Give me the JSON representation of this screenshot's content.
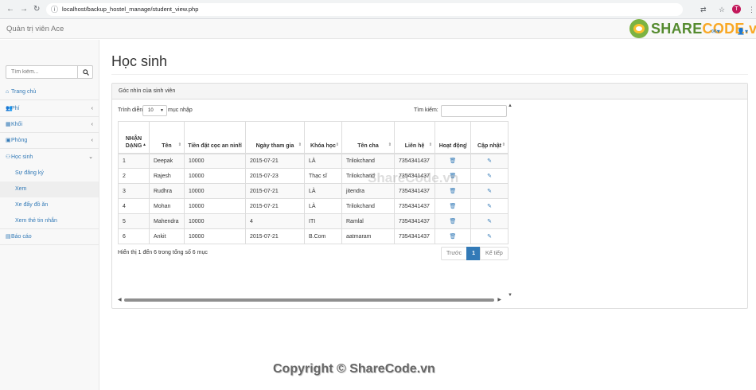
{
  "browser": {
    "url": "localhost/backup_hostel_manage/student_view.php",
    "profile_initial": "T"
  },
  "navbar": {
    "brand": "Quản trị viên Ace",
    "logo_text_a": "SHARE",
    "logo_text_b": "CODE.vn"
  },
  "sidebar": {
    "search_placeholder": "Tìm kiếm...",
    "items": [
      {
        "label": "Trang chủ"
      },
      {
        "label": "Phí"
      },
      {
        "label": "Khối"
      },
      {
        "label": "Phòng"
      },
      {
        "label": "Học sinh"
      },
      {
        "label": "Báo cáo"
      }
    ],
    "sub_items": [
      {
        "label": "Sự đăng ký"
      },
      {
        "label": "Xem"
      },
      {
        "label": "Xe đẩy đồ ăn"
      },
      {
        "label": "Xem thẻ tin nhắn"
      }
    ]
  },
  "main": {
    "title": "Học sinh",
    "panel_heading": "Góc nhìn của sinh viên",
    "length_label_before": "Trình diễn",
    "length_value": "10",
    "length_label_after": "mục nhập",
    "search_label": "Tìm kiếm:",
    "columns": [
      "NHẬN DẠNG",
      "Tên",
      "Tiền đặt cọc an ninh",
      "Ngày tham gia",
      "Khóa học",
      "Tên cha",
      "Liên hệ",
      "Hoạt động",
      "Cập nhật"
    ],
    "rows": [
      [
        "1",
        "Deepak",
        "10000",
        "2015-07-21",
        "LÀ",
        "Trilokchand",
        "7354341437"
      ],
      [
        "2",
        "Rajesh",
        "10000",
        "2015-07-23",
        "Thạc sĩ",
        "Trilokchand",
        "7354341437"
      ],
      [
        "3",
        "Rudhra",
        "10000",
        "2015-07-21",
        "LÀ",
        "jitendra",
        "7354341437"
      ],
      [
        "4",
        "Mohan",
        "10000",
        "2015-07-21",
        "LÀ",
        "Trilokchand",
        "7354341437"
      ],
      [
        "5",
        "Mahendra",
        "10000",
        "4",
        "ITI",
        "Ramlal",
        "7354341437"
      ],
      [
        "6",
        "Ankit",
        "10000",
        "2015-07-21",
        "B.Com",
        "aatmaram",
        "7354341437"
      ]
    ],
    "info": "Hiển thị 1 đến 6 trong tổng số 6 mục",
    "pager": {
      "prev": "Trước",
      "current": "1",
      "next": "Kế tiếp"
    }
  },
  "watermarks": {
    "center": "ShareCode.vn",
    "footer": "Copyright © ShareCode.vn"
  },
  "colors": {
    "link": "#337ab7",
    "logo_green": "#558b2f",
    "logo_orange": "#f9a825"
  }
}
